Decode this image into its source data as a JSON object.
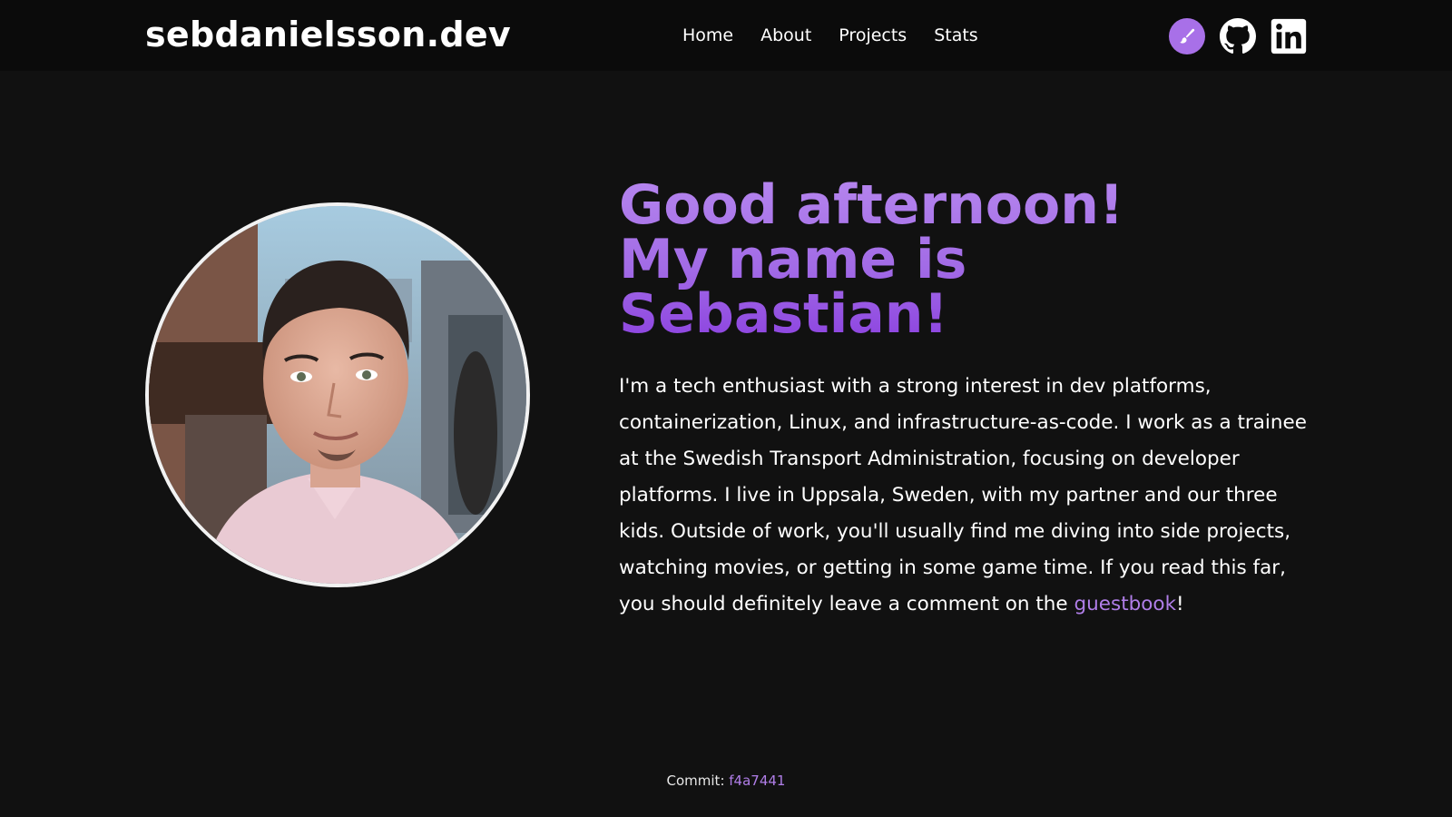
{
  "header": {
    "brand": "sebdanielsson.dev",
    "nav": [
      "Home",
      "About",
      "Projects",
      "Stats"
    ],
    "icons": [
      "paintbrush-icon",
      "github-icon",
      "linkedin-icon"
    ]
  },
  "hero": {
    "greeting_lines": [
      "Good afternoon!",
      "My name is",
      "Sebastian!"
    ],
    "bio": "I'm a tech enthusiast with a strong interest in dev platforms, containerization, Linux, and infrastructure-as-code. I work as a trainee at the Swedish Transport Administration, focusing on developer platforms. I live in Uppsala, Sweden, with my partner and our three kids. Outside of work, you'll usually find me diving into side projects, watching movies, or getting in some game time. If you read this far, you should definitely leave a comment on the ",
    "link_text": "guestbook",
    "bio_end": "!"
  },
  "footer": {
    "label": "Commit:",
    "commit": "f4a7441"
  },
  "colors": {
    "background": "#111111",
    "header_background": "#0b0b0b",
    "accent": "#a870e8"
  }
}
